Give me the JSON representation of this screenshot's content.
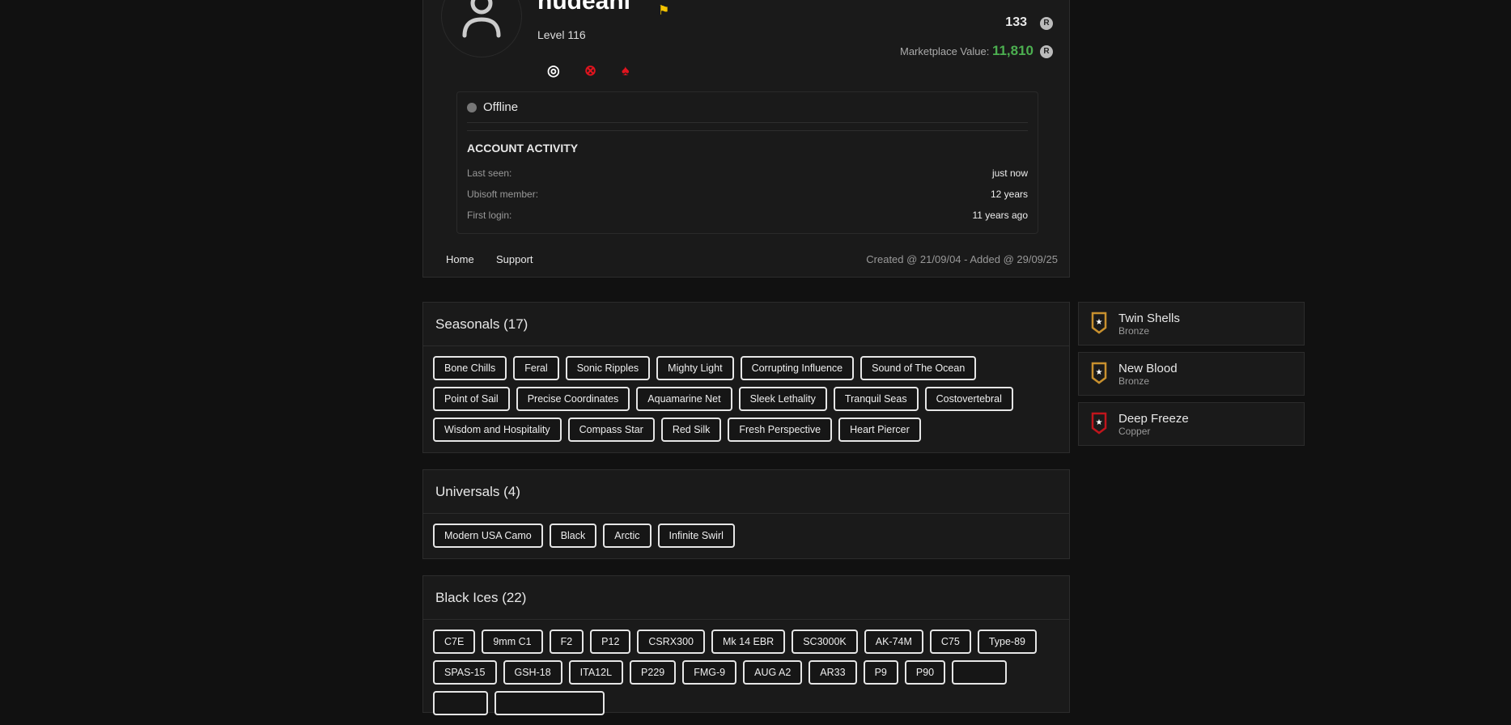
{
  "profile": {
    "username": "nudeani",
    "level": "Level 116",
    "credits": "133",
    "marketplace_label": "Marketplace Value:",
    "marketplace_value": "11,810",
    "status": "Offline",
    "activity_title": "ACCOUNT ACTIVITY",
    "activity": [
      {
        "label": "Last seen:",
        "value": "just now"
      },
      {
        "label": "Ubisoft member:",
        "value": "12 years"
      },
      {
        "label": "First login:",
        "value": "11 years ago"
      }
    ],
    "nav": [
      "Home",
      "Support"
    ],
    "created": "Created @ 21/09/04 - Added @ 29/09/25"
  },
  "colors": {
    "accent_green": "#4caf50",
    "flag": "#f5c400",
    "platform_red": "#e0141e"
  },
  "seasonals": {
    "title": "Seasonals (17)",
    "items": [
      "Bone Chills",
      "Feral",
      "Sonic Ripples",
      "Mighty Light",
      "Corrupting Influence",
      "Sound of The Ocean",
      "Point of Sail",
      "Precise Coordinates",
      "Aquamarine Net",
      "Sleek Lethality",
      "Tranquil Seas",
      "Costovertebral",
      "Wisdom and Hospitality",
      "Compass Star",
      "Red Silk",
      "Fresh Perspective",
      "Heart Piercer"
    ]
  },
  "universals": {
    "title": "Universals (4)",
    "items": [
      "Modern USA Camo",
      "Black",
      "Arctic",
      "Infinite Swirl"
    ]
  },
  "black_ices": {
    "title": "Black Ices (22)",
    "items": [
      "C7E",
      "9mm C1",
      "F2",
      "P12",
      "CSRX300",
      "Mk 14 EBR",
      "SC3000K",
      "AK-74M",
      "C75",
      "Type-89",
      "SPAS-15",
      "GSH-18",
      "ITA12L",
      "P229",
      "FMG-9",
      "AUG A2",
      "AR33",
      "P9",
      "P90"
    ]
  },
  "badges": [
    {
      "name": "Twin Shells",
      "tier": "Bronze"
    },
    {
      "name": "New Blood",
      "tier": "Bronze"
    },
    {
      "name": "Deep Freeze",
      "tier": "Copper"
    }
  ]
}
